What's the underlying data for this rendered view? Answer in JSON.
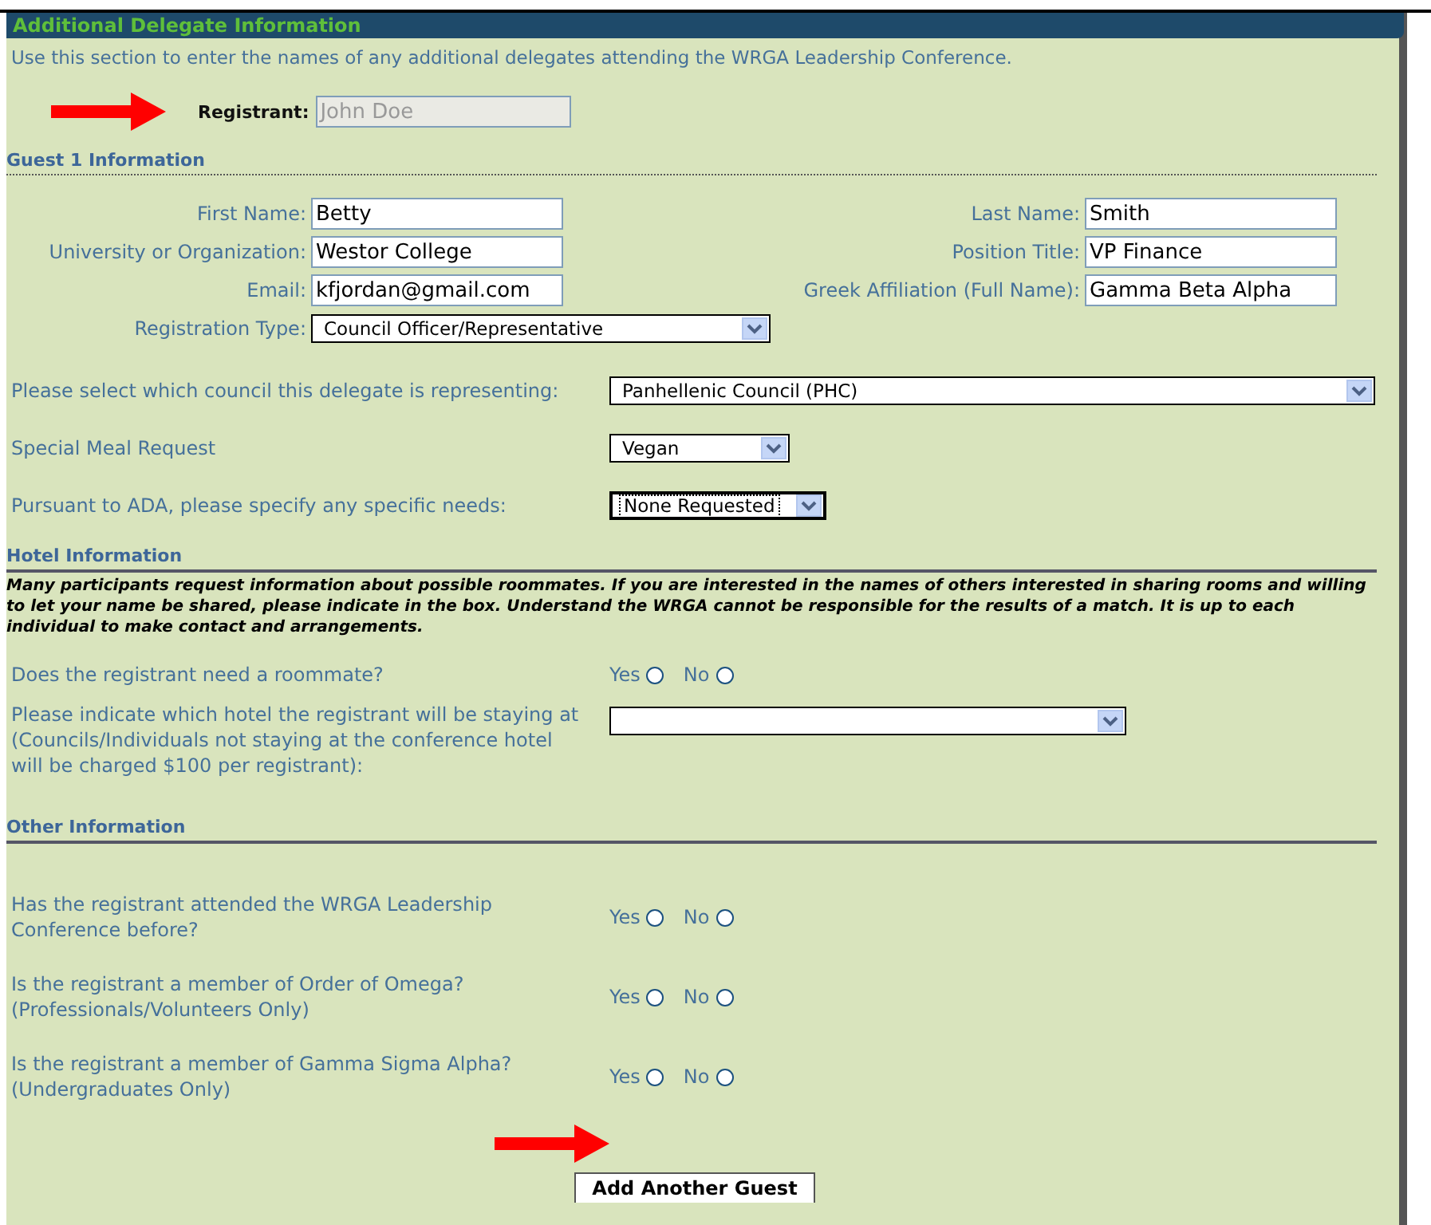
{
  "section_title": "Additional Delegate Information",
  "intro": "Use this section to enter the names of any additional delegates attending the WRGA Leadership Conference.",
  "registrant": {
    "label": "Registrant:",
    "value": "John Doe",
    "disabled": true
  },
  "guest_heading": "Guest 1 Information",
  "fields_left": [
    {
      "label": "First Name:",
      "value": "Betty"
    },
    {
      "label": "University or Organization:",
      "value": "Westor College"
    },
    {
      "label": "Email:",
      "value": "kfjordan@gmail.com"
    }
  ],
  "fields_right": [
    {
      "label": "Last Name:",
      "value": "Smith"
    },
    {
      "label": "Position Title:",
      "value": "VP Finance"
    },
    {
      "label": "Greek Affiliation (Full Name):",
      "value": "Gamma Beta Alpha"
    }
  ],
  "registration_type": {
    "label": "Registration Type:",
    "value": "Council Officer/Representative"
  },
  "selects": [
    {
      "kind": "wide",
      "label": "Please select which council this delegate is representing:",
      "value": "Panhellenic Council (PHC)",
      "focused": false
    },
    {
      "kind": "small",
      "label": "Special Meal Request",
      "value": "Vegan",
      "focused": false
    },
    {
      "kind": "medium",
      "label": "Pursuant to ADA, please specify any specific needs:",
      "value": "None Requested",
      "focused": true
    }
  ],
  "hotel": {
    "heading": "Hotel Information",
    "note": "Many participants request information about possible roommates. If you are interested in the names of others interested in sharing rooms and willing to let your name be shared, please indicate in the box. Understand the WRGA cannot be responsible for the results of a match. It is up to each individual to make contact and arrangements.",
    "roommate": {
      "question": "Does the registrant need a roommate?",
      "options": [
        {
          "label": "Yes",
          "selected": false
        },
        {
          "label": "No",
          "selected": false
        }
      ]
    },
    "hotel_select": {
      "label": "Please indicate which hotel the registrant will be staying at (Councils/Individuals not staying at the conference hotel will be charged $100 per registrant):"
    }
  },
  "other": {
    "heading": "Other Information",
    "questions": [
      {
        "question": "Has the registrant attended the WRGA Leadership Conference before?",
        "options": [
          {
            "label": "Yes",
            "selected": false
          },
          {
            "label": "No",
            "selected": false
          }
        ]
      },
      {
        "question": "Is the registrant a member of Order of Omega? (Professionals/Volunteers Only)",
        "options": [
          {
            "label": "Yes",
            "selected": false
          },
          {
            "label": "No",
            "selected": false
          }
        ]
      },
      {
        "question": "Is the registrant a member of Gamma Sigma Alpha? (Undergraduates Only)",
        "options": [
          {
            "label": "Yes",
            "selected": false
          },
          {
            "label": "No",
            "selected": false
          }
        ]
      }
    ]
  },
  "add_button": "Add Another Guest"
}
